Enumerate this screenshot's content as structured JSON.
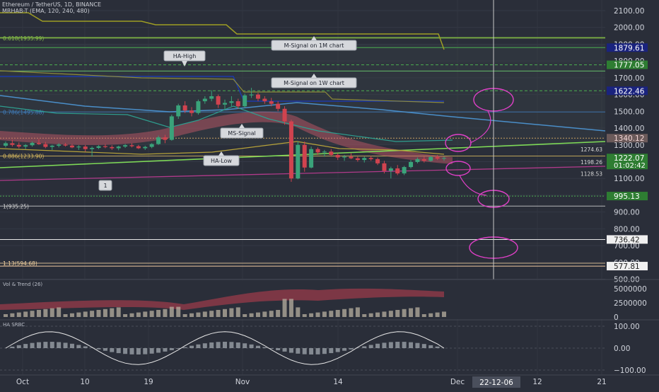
{
  "header": {
    "symbol_line": "Ethereum / TetherUS, 1D, BINANCE",
    "indicator_line": "MRHAB-T (EMA, 120, 240, 480)"
  },
  "chart_data": {
    "type": "candlestick",
    "price_axis": {
      "ticks": [
        {
          "v": 2100,
          "label": "2100.00"
        },
        {
          "v": 2000,
          "label": "2000.00"
        },
        {
          "v": 1900,
          "label": "1900.00"
        },
        {
          "v": 1800,
          "label": "1800.00"
        },
        {
          "v": 1700,
          "label": "1700.00"
        },
        {
          "v": 1600,
          "label": "1600.00"
        },
        {
          "v": 1500,
          "label": "1500.00"
        },
        {
          "v": 1400,
          "label": "1400.00"
        },
        {
          "v": 1300,
          "label": "1300.00"
        },
        {
          "v": 1200,
          "label": "1200.00"
        },
        {
          "v": 1100,
          "label": "1100.00"
        },
        {
          "v": 1000,
          "label": "1000.00"
        },
        {
          "v": 900,
          "label": "900.00"
        },
        {
          "v": 800,
          "label": "800.00"
        },
        {
          "v": 700,
          "label": "700.00"
        },
        {
          "v": 600,
          "label": "600.00"
        },
        {
          "v": 500,
          "label": "500.00"
        }
      ],
      "price_tags": [
        {
          "v": 1879.61,
          "label": "1879.61",
          "bg": "#1a237e",
          "fg": "#ffffff"
        },
        {
          "v": 1777.05,
          "label": "1777.05",
          "bg": "#2e7d32",
          "fg": "#ffffff"
        },
        {
          "v": 1622.46,
          "label": "1622.46",
          "bg": "#1a237e",
          "fg": "#ffffff"
        },
        {
          "v": 1340.12,
          "label": "1340.12",
          "bg": "#6b5a5a",
          "fg": "#f3d6d6"
        },
        {
          "v": 1222.07,
          "label": "1222.07",
          "bg": "#2e7d32",
          "fg": "#ffffff",
          "sub": "01:02:42"
        },
        {
          "v": 995.13,
          "label": "995.13",
          "bg": "#2e7d32",
          "fg": "#ffffff"
        },
        {
          "v": 736.42,
          "label": "736.42",
          "bg": "#f0f0f0",
          "fg": "#222222"
        },
        {
          "v": 577.81,
          "label": "577.81",
          "bg": "#f0f0f0",
          "fg": "#222222"
        }
      ]
    },
    "date_axis": {
      "labels": [
        "Oct",
        "10",
        "19",
        "Nov",
        "14",
        "Dec",
        "12",
        "21"
      ],
      "cursor_label": "22-12-06"
    },
    "fib_levels": [
      {
        "v": 1935.99,
        "label": "0.618(1935.99)"
      },
      {
        "v": 1495.88,
        "label": "0.786(1495.88)"
      },
      {
        "v": 1233.9,
        "label": "0.886(1233.90)"
      },
      {
        "v": 935.25,
        "label": "1(935.25)"
      },
      {
        "v": 594.68,
        "label": "1.13(594.68)"
      }
    ],
    "level_labels": [
      {
        "v": 1274.63,
        "label": "1274.63"
      },
      {
        "v": 1198.26,
        "label": "1198.26"
      },
      {
        "v": 1128.53,
        "label": "1128.53"
      }
    ],
    "annotations": [
      {
        "text": "M-Signal on 1M chart"
      },
      {
        "text": "HA-High"
      },
      {
        "text": "M-Signal on 1W chart"
      },
      {
        "text": "MS-Signal"
      },
      {
        "text": "HA-Low"
      },
      {
        "text": "1"
      }
    ],
    "candles": [
      [
        1295,
        1320,
        1285,
        1310
      ],
      [
        1310,
        1330,
        1290,
        1300
      ],
      [
        1300,
        1315,
        1280,
        1290
      ],
      [
        1290,
        1305,
        1275,
        1298
      ],
      [
        1298,
        1320,
        1290,
        1312
      ],
      [
        1312,
        1335,
        1300,
        1305
      ],
      [
        1305,
        1318,
        1280,
        1288
      ],
      [
        1288,
        1300,
        1270,
        1295
      ],
      [
        1295,
        1310,
        1285,
        1302
      ],
      [
        1302,
        1312,
        1290,
        1296
      ],
      [
        1296,
        1305,
        1280,
        1285
      ],
      [
        1285,
        1298,
        1270,
        1290
      ],
      [
        1290,
        1300,
        1260,
        1275
      ],
      [
        1275,
        1290,
        1230,
        1282
      ],
      [
        1282,
        1298,
        1275,
        1292
      ],
      [
        1292,
        1305,
        1280,
        1287
      ],
      [
        1287,
        1298,
        1270,
        1280
      ],
      [
        1280,
        1295,
        1268,
        1290
      ],
      [
        1290,
        1305,
        1282,
        1298
      ],
      [
        1298,
        1310,
        1285,
        1292
      ],
      [
        1292,
        1300,
        1275,
        1280
      ],
      [
        1280,
        1295,
        1270,
        1288
      ],
      [
        1288,
        1310,
        1280,
        1305
      ],
      [
        1305,
        1355,
        1300,
        1345
      ],
      [
        1345,
        1360,
        1310,
        1330
      ],
      [
        1330,
        1480,
        1325,
        1470
      ],
      [
        1470,
        1545,
        1455,
        1535
      ],
      [
        1535,
        1560,
        1490,
        1505
      ],
      [
        1505,
        1525,
        1470,
        1490
      ],
      [
        1490,
        1570,
        1480,
        1560
      ],
      [
        1560,
        1590,
        1545,
        1575
      ],
      [
        1575,
        1625,
        1560,
        1590
      ],
      [
        1590,
        1600,
        1520,
        1540
      ],
      [
        1540,
        1570,
        1510,
        1550
      ],
      [
        1550,
        1590,
        1530,
        1560
      ],
      [
        1560,
        1575,
        1515,
        1530
      ],
      [
        1530,
        1605,
        1520,
        1595
      ],
      [
        1595,
        1640,
        1580,
        1600
      ],
      [
        1600,
        1610,
        1560,
        1575
      ],
      [
        1575,
        1590,
        1545,
        1560
      ],
      [
        1560,
        1580,
        1530,
        1545
      ],
      [
        1545,
        1560,
        1500,
        1515
      ],
      [
        1515,
        1530,
        1420,
        1440
      ],
      [
        1440,
        1450,
        1080,
        1100
      ],
      [
        1100,
        1320,
        1095,
        1300
      ],
      [
        1300,
        1320,
        1140,
        1165
      ],
      [
        1165,
        1290,
        1160,
        1275
      ],
      [
        1275,
        1285,
        1240,
        1255
      ],
      [
        1255,
        1270,
        1230,
        1260
      ],
      [
        1260,
        1275,
        1230,
        1240
      ],
      [
        1240,
        1250,
        1210,
        1225
      ],
      [
        1225,
        1240,
        1205,
        1230
      ],
      [
        1230,
        1250,
        1215,
        1220
      ],
      [
        1220,
        1230,
        1200,
        1210
      ],
      [
        1210,
        1230,
        1195,
        1222
      ],
      [
        1222,
        1235,
        1205,
        1215
      ],
      [
        1215,
        1225,
        1180,
        1190
      ],
      [
        1190,
        1205,
        1130,
        1145
      ],
      [
        1145,
        1170,
        1100,
        1160
      ],
      [
        1160,
        1180,
        1120,
        1130
      ],
      [
        1130,
        1175,
        1120,
        1168
      ],
      [
        1168,
        1210,
        1160,
        1198
      ],
      [
        1198,
        1225,
        1190,
        1215
      ],
      [
        1215,
        1230,
        1195,
        1205
      ],
      [
        1205,
        1235,
        1200,
        1228
      ],
      [
        1228,
        1240,
        1210,
        1218
      ],
      [
        1218,
        1230,
        1205,
        1222
      ]
    ],
    "vol_pane": {
      "title": "Vol & Trend (26)",
      "ticks": [
        {
          "v": 5000000,
          "label": "5000000"
        },
        {
          "v": 2500000,
          "label": "2500000"
        },
        {
          "v": 0,
          "label": "0"
        }
      ]
    },
    "osc_pane": {
      "title": "HA SRBC",
      "ticks": [
        {
          "v": 100,
          "label": "100.00"
        },
        {
          "v": 0,
          "label": "0.00"
        },
        {
          "v": -100,
          "label": "−100.00"
        }
      ]
    }
  }
}
